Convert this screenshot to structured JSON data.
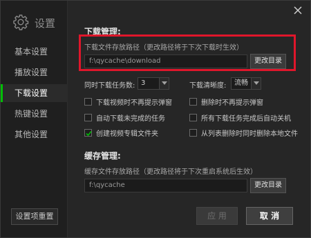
{
  "window": {
    "close_icon": "close-icon"
  },
  "sidebar": {
    "title": "设置",
    "icon": "gear-icon",
    "items": [
      {
        "label": "基本设置",
        "active": false
      },
      {
        "label": "播放设置",
        "active": false
      },
      {
        "label": "下载设置",
        "active": true
      },
      {
        "label": "热键设置",
        "active": false
      },
      {
        "label": "其他设置",
        "active": false
      }
    ],
    "reset_label": "设置项重置"
  },
  "download": {
    "title": "下载管理:",
    "path_hint": "下载文件存放路径（更改路径将于下次下载时生效）",
    "path_value": "f:\\qycache\\download",
    "change_dir_label": "更改目录",
    "tasks_label": "同时下载任务数:",
    "tasks_value": "3",
    "quality_label": "下载清晰度:",
    "quality_value": "流畅",
    "options": [
      {
        "label": "下载视频时不再提示弹窗",
        "checked": false
      },
      {
        "label": "删除时不再提示弹窗",
        "checked": false
      },
      {
        "label": "自动下载未完成的任务",
        "checked": false
      },
      {
        "label": "所有下载任务完成后自动关机",
        "checked": false
      },
      {
        "label": "创建视频专辑文件夹",
        "checked": true
      },
      {
        "label": "从列表删除时同时删除本地文件",
        "checked": false
      }
    ]
  },
  "cache": {
    "title": "缓存管理:",
    "path_hint": "缓存文件存放路径（更改路径将于下次重启系统后生效）",
    "path_value": "f:\\qycache",
    "change_dir_label": "更改目录"
  },
  "footer": {
    "apply_label": "应 用",
    "cancel_label": "取 消"
  },
  "colors": {
    "accent": "#00be06",
    "highlight": "#e0162b"
  }
}
